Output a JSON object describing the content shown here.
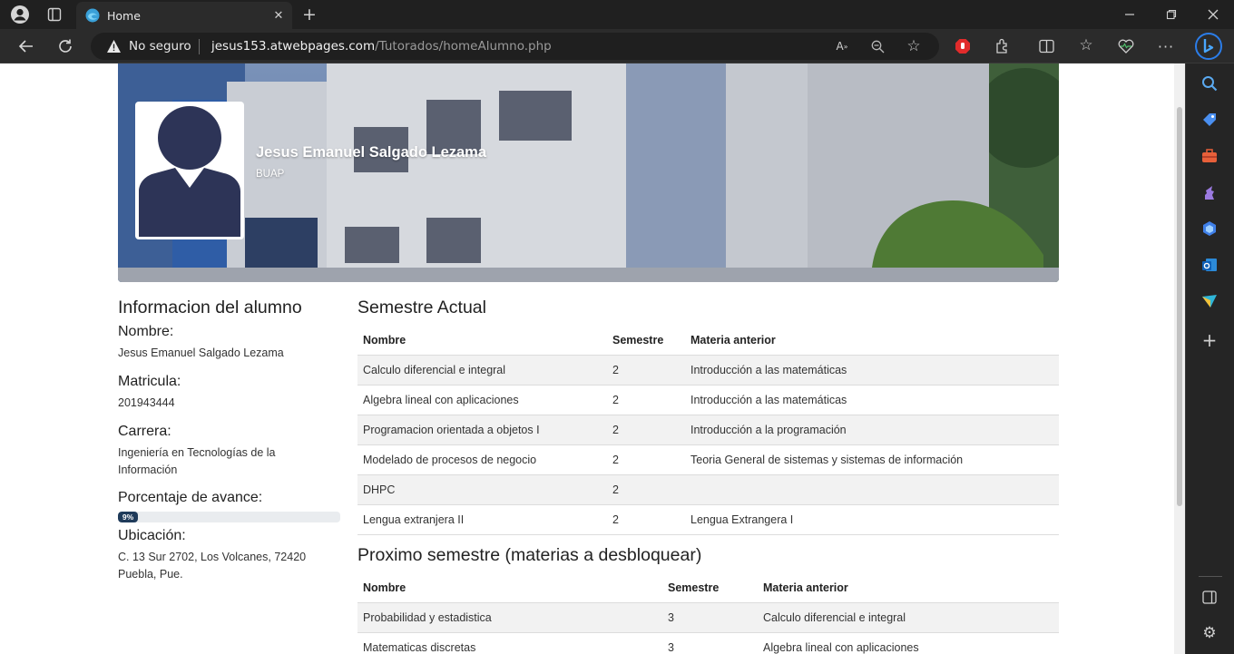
{
  "browser": {
    "tab_title": "Home",
    "security_label": "No seguro",
    "url_host": "jesus153.atwebpages.com",
    "url_path": "/Tutorados/homeAlumno.php"
  },
  "hero": {
    "student_name": "Jesus Emanuel Salgado Lezama",
    "institution": "BUAP"
  },
  "info": {
    "title": "Informacion del alumno",
    "name_label": "Nombre:",
    "name_value": "Jesus Emanuel Salgado Lezama",
    "matricula_label": "Matricula:",
    "matricula_value": "201943444",
    "carrera_label": "Carrera:",
    "carrera_value": "Ingeniería en Tecnologías de la Información",
    "avance_label": "Porcentaje de avance:",
    "avance_value": "9%",
    "avance_fraction": 0.09,
    "ubicacion_label": "Ubicación:",
    "ubicacion_line1": "C. 13 Sur 2702, Los Volcanes, 72420",
    "ubicacion_line2": "Puebla, Pue."
  },
  "current": {
    "title": "Semestre Actual",
    "headers": [
      "Nombre",
      "Semestre",
      "Materia anterior"
    ],
    "rows": [
      [
        "Calculo diferencial e integral",
        "2",
        "Introducción a las matemáticas"
      ],
      [
        "Algebra lineal con aplicaciones",
        "2",
        "Introducción a las matemáticas"
      ],
      [
        "Programacion orientada a objetos I",
        "2",
        "Introducción a la programación"
      ],
      [
        "Modelado de procesos de negocio",
        "2",
        "Teoria General de sistemas y sistemas de información"
      ],
      [
        "DHPC",
        "2",
        ""
      ],
      [
        "Lengua extranjera II",
        "2",
        "Lengua Extrangera I"
      ]
    ]
  },
  "next": {
    "title": "Proximo semestre (materias a desbloquear)",
    "headers": [
      "Nombre",
      "Semestre",
      "Materia anterior"
    ],
    "rows": [
      [
        "Probabilidad y estadistica",
        "3",
        "Calculo diferencial e integral"
      ],
      [
        "Matematicas discretas",
        "3",
        "Algebra lineal con aplicaciones"
      ]
    ]
  }
}
